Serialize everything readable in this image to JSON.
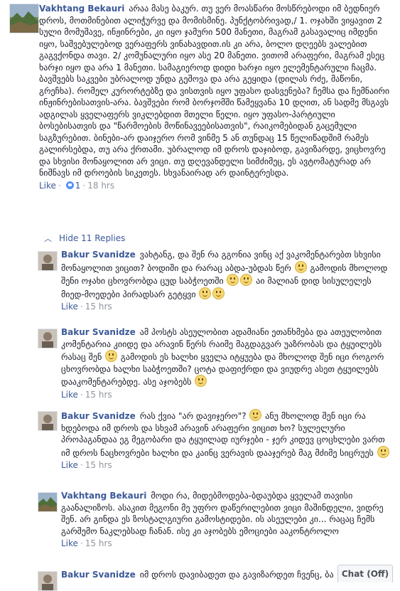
{
  "post_comment": {
    "author": "Vakhtang Bekauri",
    "text": "არაა მასე ბაკურ. თუ ვერ მოასწარი მოსწრებოდი იმ ბედნიერ დროს, მოთმინებით ალიჭურვე და მომისმინე. პუნქტობრივად,/ 1. ოჯახში ვიყავით 2 სული მომუშავე, ინჟინრები, კი იყო ჯამური 500 მანეთი, მაგრამ გასავალიც იმდენი იყო, საშვებულებოდ ვერაფერს ვინახავდით.ის კი არა, ბოლო დღეებს ვალებით გაგვქონდა თავი. 2/ კომუნალური იყო ასე 20 მანეთი. ვითომ არაფერი, მაგრამ ესეც ხარჯი იყო და არა 1 მანეთი. სამაგიეროდ დიდი ხარჯი იყო ელემენტარული ჩაცმა. ბავშვებს საკვები უბრალოდ უნდა გეშოვა და არა გეყიდა (დილას რძე, მაწონი, გრეჩხა). რომელ კურორტებზე და ვისთვის იყო უფასო დასვენება? ჩემსა და ჩემნაირი ინჟინრებისათვის-არა. ბავშვები რომ ბორჯომში წამეყვანა 10 დღით, ან სადმე მსგავს ადგილას ყველაფერს ვიკლებდით მთელი წელი. იყო უფასო-პარტიული ბოსებისათვის და \"წარმოების მოწინავეებისათვის\", რაიკომებიდან გაცემული საგზურებით. ბინები-არ დაიჯერო რომ ვინმე 5 ან თუნდაც 15 წელიწადშიმ რამეს გალირსებდა, თუ არა ქრთამი. უბრალოდ იმ დროს დაჯიბოდ, გავიზარდე, ვიცხოვრე და სხვისი მონაყოლით არ ვიცი. თუ დღევანდელი სიმძიმეც, ეს ავტომატურად არ ნიშნავს იმ დროების სიკეთეს. სხვანაირად არ დაინტერესდა.",
    "like": "Like",
    "like_count": "1",
    "time": "18 hrs"
  },
  "hide_replies": "Hide 11 Replies",
  "replies": [
    {
      "author": "Bakur Svanidze",
      "text_a": "ვახტანგ, და შენ რა გგონია ვინც აქ ვაკომენტარებთ სხვისი მონაყოლით ვიცით? ბოდიში და რარაც აბდა-უბდას წერ",
      "text_b": "გამოდის მხოლოდ შენი ოჯახი ცხოვრობდა ცუდ საბჭოეთში",
      "text_c": "აი მალიან დიდ სისულელეს მიედ-მოედები პირადსარ გეტყვი",
      "like": "Like",
      "time": "15 hrs"
    },
    {
      "author": "Bakur Svanidze",
      "text_a": "ამ პოსტს ასეულობით ადამიანი ეთანხმება და ათეულობით კომენტარია კიიდე და არავინ წერს რაიმე მაგდაგვარ უაზრობას და ტყუილებს რასაც შენ",
      "text_b": "გამოდის ეს ხალხი ყველა იტყუება და მხოლოდ შენ იცი როგორ ცხოვრობდა ხალხი საბჭოეთში? ცოტა დაფიქრდი და ვიუდრე ასეთ ტყუილებს დააკომენტარებდე. ასე აჯობებს",
      "like": "Like",
      "time": "15 hrs"
    },
    {
      "author": "Bakur Svanidze",
      "text_a": "რას ქვია \"არ დავიჯერო\"?",
      "text_b": "ანუ მხოლოდ შენ იცი რა ხდებოდა იმ დროს და სხვამ არავინ არაფერი ვიცით ხო? სულელური პროპაგანდაა ეგ მეგობარი და ტყუილად იურჯები - ჯერ კიდევ ცოცხლები ვართ იმ დროს ნაცხოვრები ხალხი და კაინც ვერავის დააჯერებ მაგ მძიმე სიცრუეს",
      "like": "Like",
      "time": "15 hrs"
    },
    {
      "author": "Vakhtang Bekauri",
      "text_a": "მოდი რა, მიდებმოდება-ბდაუბდა ყველამ თავისი გაანალიზოს. ასაკით მეგონი მე უფრო დაწერილებით ვიცი მაშინდელი, ვიდრე შენ. არ გინდა ეს ზოსტალგიური გამოსტიდები. ის ასეულები კი... რაცაც ჩემს გარშემო ნაკლებსად ჩანან. ისე კი აჯობებს ემოციები ააკონტროლო",
      "like": "Like",
      "time": "15 hrs"
    },
    {
      "author": "Bakur Svanidze",
      "text_a": "იმ დროს დავიბადეთ და გავიზარდეთ ჩვენც, ბა"
    }
  ],
  "chat": {
    "label": "Chat (Off)"
  }
}
